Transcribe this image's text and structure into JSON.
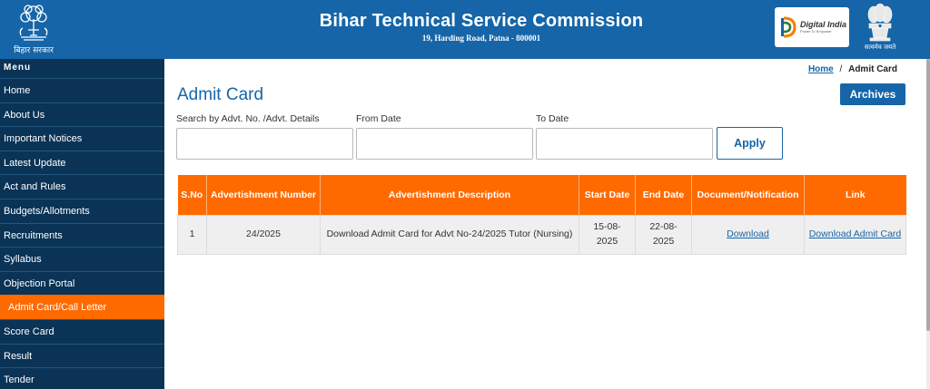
{
  "header": {
    "state_caption": "बिहार सरकार",
    "title": "Bihar Technical Service Commission",
    "address": "19, Harding Road, Patna - 800001",
    "digital_india": {
      "name": "Digital India",
      "tagline": "Power To Empower"
    },
    "emblem_caption": "सत्यमेव जयते",
    "colors": {
      "header_bg": "#1565a8",
      "accent": "#ff6a00",
      "sidebar_bg": "#0a3356"
    }
  },
  "sidebar": {
    "heading": "Menu",
    "items": [
      {
        "label": "Home"
      },
      {
        "label": "About Us"
      },
      {
        "label": "Important Notices"
      },
      {
        "label": "Latest Update"
      },
      {
        "label": "Act and Rules"
      },
      {
        "label": "Budgets/Allotments"
      },
      {
        "label": "Recruitments"
      },
      {
        "label": "Syllabus"
      },
      {
        "label": "Objection Portal"
      },
      {
        "label": "Admit Card/Call Letter",
        "active": true
      },
      {
        "label": "Score Card"
      },
      {
        "label": "Result"
      },
      {
        "label": "Tender"
      }
    ]
  },
  "breadcrumb": {
    "home": "Home",
    "separator": "/",
    "current": "Admit Card"
  },
  "page": {
    "title": "Admit Card",
    "archives_label": "Archives"
  },
  "filters": {
    "search_label": "Search by Advt. No. /Advt. Details",
    "search_value": "",
    "from_label": "From Date",
    "from_value": "",
    "to_label": "To Date",
    "to_value": "",
    "apply_label": "Apply"
  },
  "table": {
    "headers": [
      "S.No",
      "Advertishment Number",
      "Advertishment Description",
      "Start Date",
      "End Date",
      "Document/Notification",
      "Link"
    ],
    "rows": [
      {
        "sno": "1",
        "advt_number": "24/2025",
        "description": "Download Admit Card for Advt No-24/2025 Tutor (Nursing)",
        "start_date": "15-08-2025",
        "end_date": "22-08-2025",
        "document": "Download",
        "link": "Download Admit Card"
      }
    ]
  }
}
